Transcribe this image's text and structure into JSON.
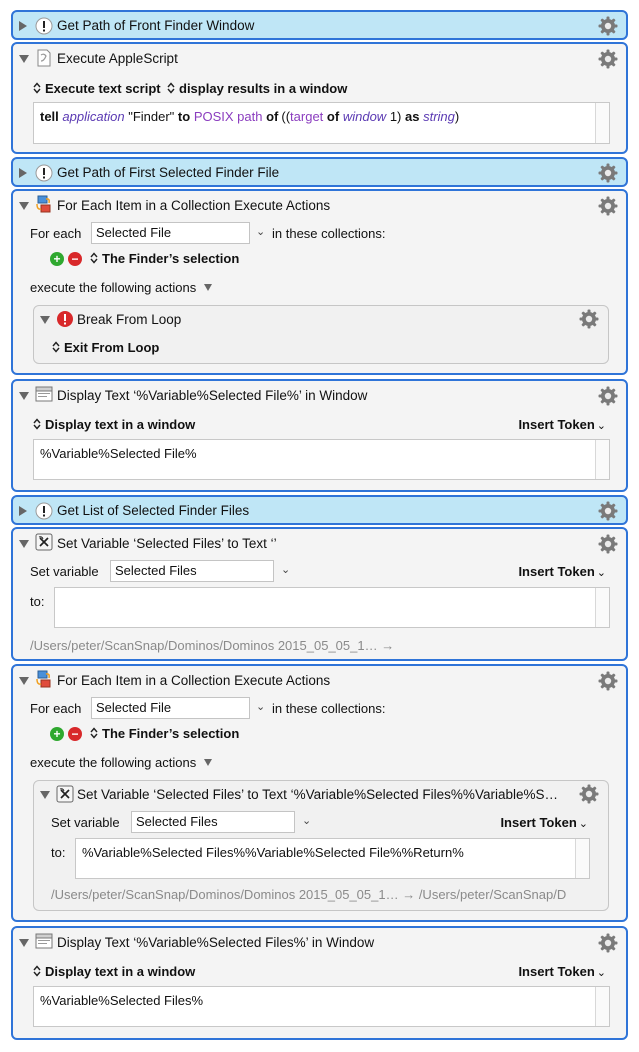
{
  "blocks": {
    "b1": {
      "title": "Get Path of Front Finder Window"
    },
    "b2": {
      "title": "Execute AppleScript",
      "opt1": "Execute text script",
      "opt2": "display results in a window",
      "script": {
        "p1": "tell",
        "p2": "application",
        "p3": "\"Finder\"",
        "p4": "to",
        "p5": "POSIX path",
        "p6": "of",
        "p7": "((",
        "p8": "target",
        "p9": "of",
        "p10": "window",
        "p11": "1)",
        "p12": "as",
        "p13": "string",
        "p14": ")"
      }
    },
    "b3": {
      "title": "Get Path of First Selected Finder File"
    },
    "b4": {
      "title": "For Each Item in a Collection Execute Actions",
      "for_each_label": "For each",
      "variable": "Selected File",
      "in_label": "in these collections:",
      "collection": "The Finder’s selection",
      "execute_label": "execute the following actions",
      "inner": {
        "title": "Break From Loop",
        "option": "Exit From Loop"
      }
    },
    "b5": {
      "title": "Display Text ‘%Variable%Selected File%’ in Window",
      "option": "Display text in a window",
      "insert_token": "Insert Token",
      "text": "%Variable%Selected File%"
    },
    "b6": {
      "title": "Get List of Selected Finder Files"
    },
    "b7": {
      "title": "Set Variable ‘Selected Files’ to Text ‘’",
      "set_label": "Set variable",
      "variable": "Selected Files",
      "insert_token": "Insert Token",
      "to_label": "to:",
      "text": "",
      "preview": "/Users/peter/ScanSnap/Dominos/Dominos 2015_05_05_1… →"
    },
    "b8": {
      "title": "For Each Item in a Collection Execute Actions",
      "for_each_label": "For each",
      "variable": "Selected File",
      "in_label": "in these collections:",
      "collection": "The Finder’s selection",
      "execute_label": "execute the following actions",
      "inner": {
        "title": "Set Variable ‘Selected Files’ to Text ‘%Variable%Selected Files%%Variable%S…",
        "set_label": "Set variable",
        "variable": "Selected Files",
        "insert_token": "Insert Token",
        "to_label": "to:",
        "text": "%Variable%Selected Files%%Variable%Selected File%%Return%",
        "preview": "/Users/peter/ScanSnap/Dominos/Dominos 2015_05_05_1… → /Users/peter/ScanSnap/D"
      }
    },
    "b9": {
      "title": "Display Text ‘%Variable%Selected Files%’ in Window",
      "option": "Display text in a window",
      "insert_token": "Insert Token",
      "text": "%Variable%Selected Files%"
    }
  },
  "colors": {
    "border": "#2f74d8",
    "collapsed_bg": "#bfe6f6",
    "expanded_bg": "#f4f4f4",
    "plus": "#2fa82f",
    "minus": "#d8282a",
    "stop": "#d8282a"
  },
  "icons": [
    "disclosure-triangle-icon",
    "comment-icon",
    "applescript-icon",
    "for-each-icon",
    "stop-icon",
    "window-icon",
    "variable-icon",
    "gear-icon",
    "plus-icon",
    "minus-icon",
    "updown-arrows-icon",
    "chevron-down-icon"
  ]
}
